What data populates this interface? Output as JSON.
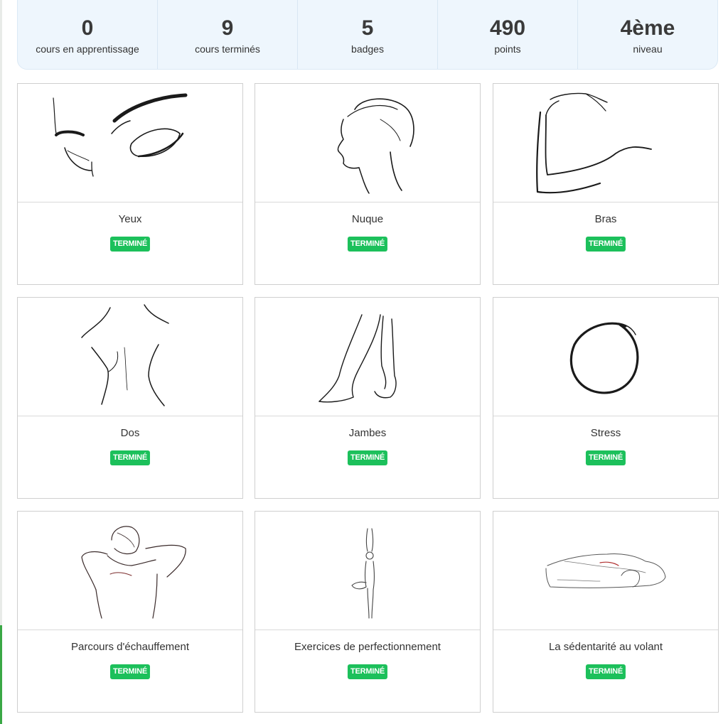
{
  "stats": [
    {
      "value": "0",
      "label": "cours en apprentissage"
    },
    {
      "value": "9",
      "label": "cours terminés"
    },
    {
      "value": "5",
      "label": "badges"
    },
    {
      "value": "490",
      "label": "points"
    },
    {
      "value": "4ème",
      "label": "niveau"
    }
  ],
  "courses": [
    {
      "title": "Yeux",
      "status": "TERMINÉ",
      "icon": "eyes-sketch-icon"
    },
    {
      "title": "Nuque",
      "status": "TERMINÉ",
      "icon": "neck-sketch-icon"
    },
    {
      "title": "Bras",
      "status": "TERMINÉ",
      "icon": "arm-sketch-icon"
    },
    {
      "title": "Dos",
      "status": "TERMINÉ",
      "icon": "back-sketch-icon"
    },
    {
      "title": "Jambes",
      "status": "TERMINÉ",
      "icon": "legs-sketch-icon"
    },
    {
      "title": "Stress",
      "status": "TERMINÉ",
      "icon": "circle-sketch-icon"
    },
    {
      "title": "Parcours d'échauffement",
      "status": "TERMINÉ",
      "icon": "stretching-woman-sketch-icon"
    },
    {
      "title": "Exercices de perfectionnement",
      "status": "TERMINÉ",
      "icon": "yoga-pose-sketch-icon"
    },
    {
      "title": "La sédentarité au volant",
      "status": "TERMINÉ",
      "icon": "car-sketch-icon"
    }
  ],
  "colors": {
    "badge": "#1cc05b",
    "stats_background": "#eef6fd"
  }
}
